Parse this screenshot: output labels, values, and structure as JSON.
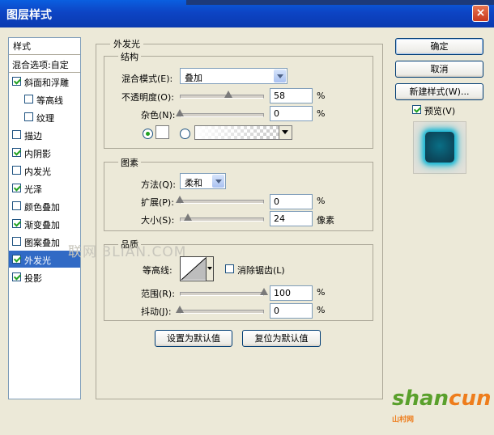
{
  "window": {
    "title": "图层样式",
    "close_glyph": "×"
  },
  "sidebar": {
    "header": "样式",
    "blend_options": "混合选项:自定",
    "items": [
      {
        "label": "斜面和浮雕",
        "checked": true,
        "indent": false
      },
      {
        "label": "等高线",
        "checked": false,
        "indent": true
      },
      {
        "label": "纹理",
        "checked": false,
        "indent": true
      },
      {
        "label": "描边",
        "checked": false,
        "indent": false
      },
      {
        "label": "内阴影",
        "checked": true,
        "indent": false
      },
      {
        "label": "内发光",
        "checked": false,
        "indent": false
      },
      {
        "label": "光泽",
        "checked": true,
        "indent": false
      },
      {
        "label": "颜色叠加",
        "checked": false,
        "indent": false
      },
      {
        "label": "渐变叠加",
        "checked": true,
        "indent": false
      },
      {
        "label": "图案叠加",
        "checked": false,
        "indent": false
      },
      {
        "label": "外发光",
        "checked": true,
        "indent": false,
        "selected": true
      },
      {
        "label": "投影",
        "checked": true,
        "indent": false
      }
    ]
  },
  "panel": {
    "title": "外发光",
    "structure": {
      "title": "结构",
      "blend_mode_label": "混合模式(E):",
      "blend_mode_value": "叠加",
      "opacity_label": "不透明度(O):",
      "opacity_value": "58",
      "opacity_pct": 58,
      "noise_label": "杂色(N):",
      "noise_value": "0",
      "noise_pct": 0,
      "unit": "%"
    },
    "elements": {
      "title": "图素",
      "method_label": "方法(Q):",
      "method_value": "柔和",
      "spread_label": "扩展(P):",
      "spread_value": "0",
      "spread_pct": 0,
      "size_label": "大小(S):",
      "size_value": "24",
      "size_frac": 0.1,
      "pct_unit": "%",
      "px_unit": "像素"
    },
    "quality": {
      "title": "品质",
      "contour_label": "等高线:",
      "antialias_label": "消除锯齿(L)",
      "range_label": "范围(R):",
      "range_value": "100",
      "range_pct": 100,
      "jitter_label": "抖动(J):",
      "jitter_value": "0",
      "jitter_pct": 0,
      "unit": "%"
    },
    "set_default": "设置为默认值",
    "reset_default": "复位为默认值"
  },
  "buttons": {
    "ok": "确定",
    "cancel": "取消",
    "new_style": "新建样式(W)...",
    "preview": "预览(V)"
  },
  "watermark": "联网 3LIAN.COM",
  "brand": {
    "text_a": "shan",
    "text_b": "cun",
    "small": "山村网"
  },
  "colors": {
    "selection": "#316ac5",
    "accent_title": "#0a3ab0",
    "preview_glow": "#12b7d6",
    "brand_green": "#5aa02c"
  }
}
